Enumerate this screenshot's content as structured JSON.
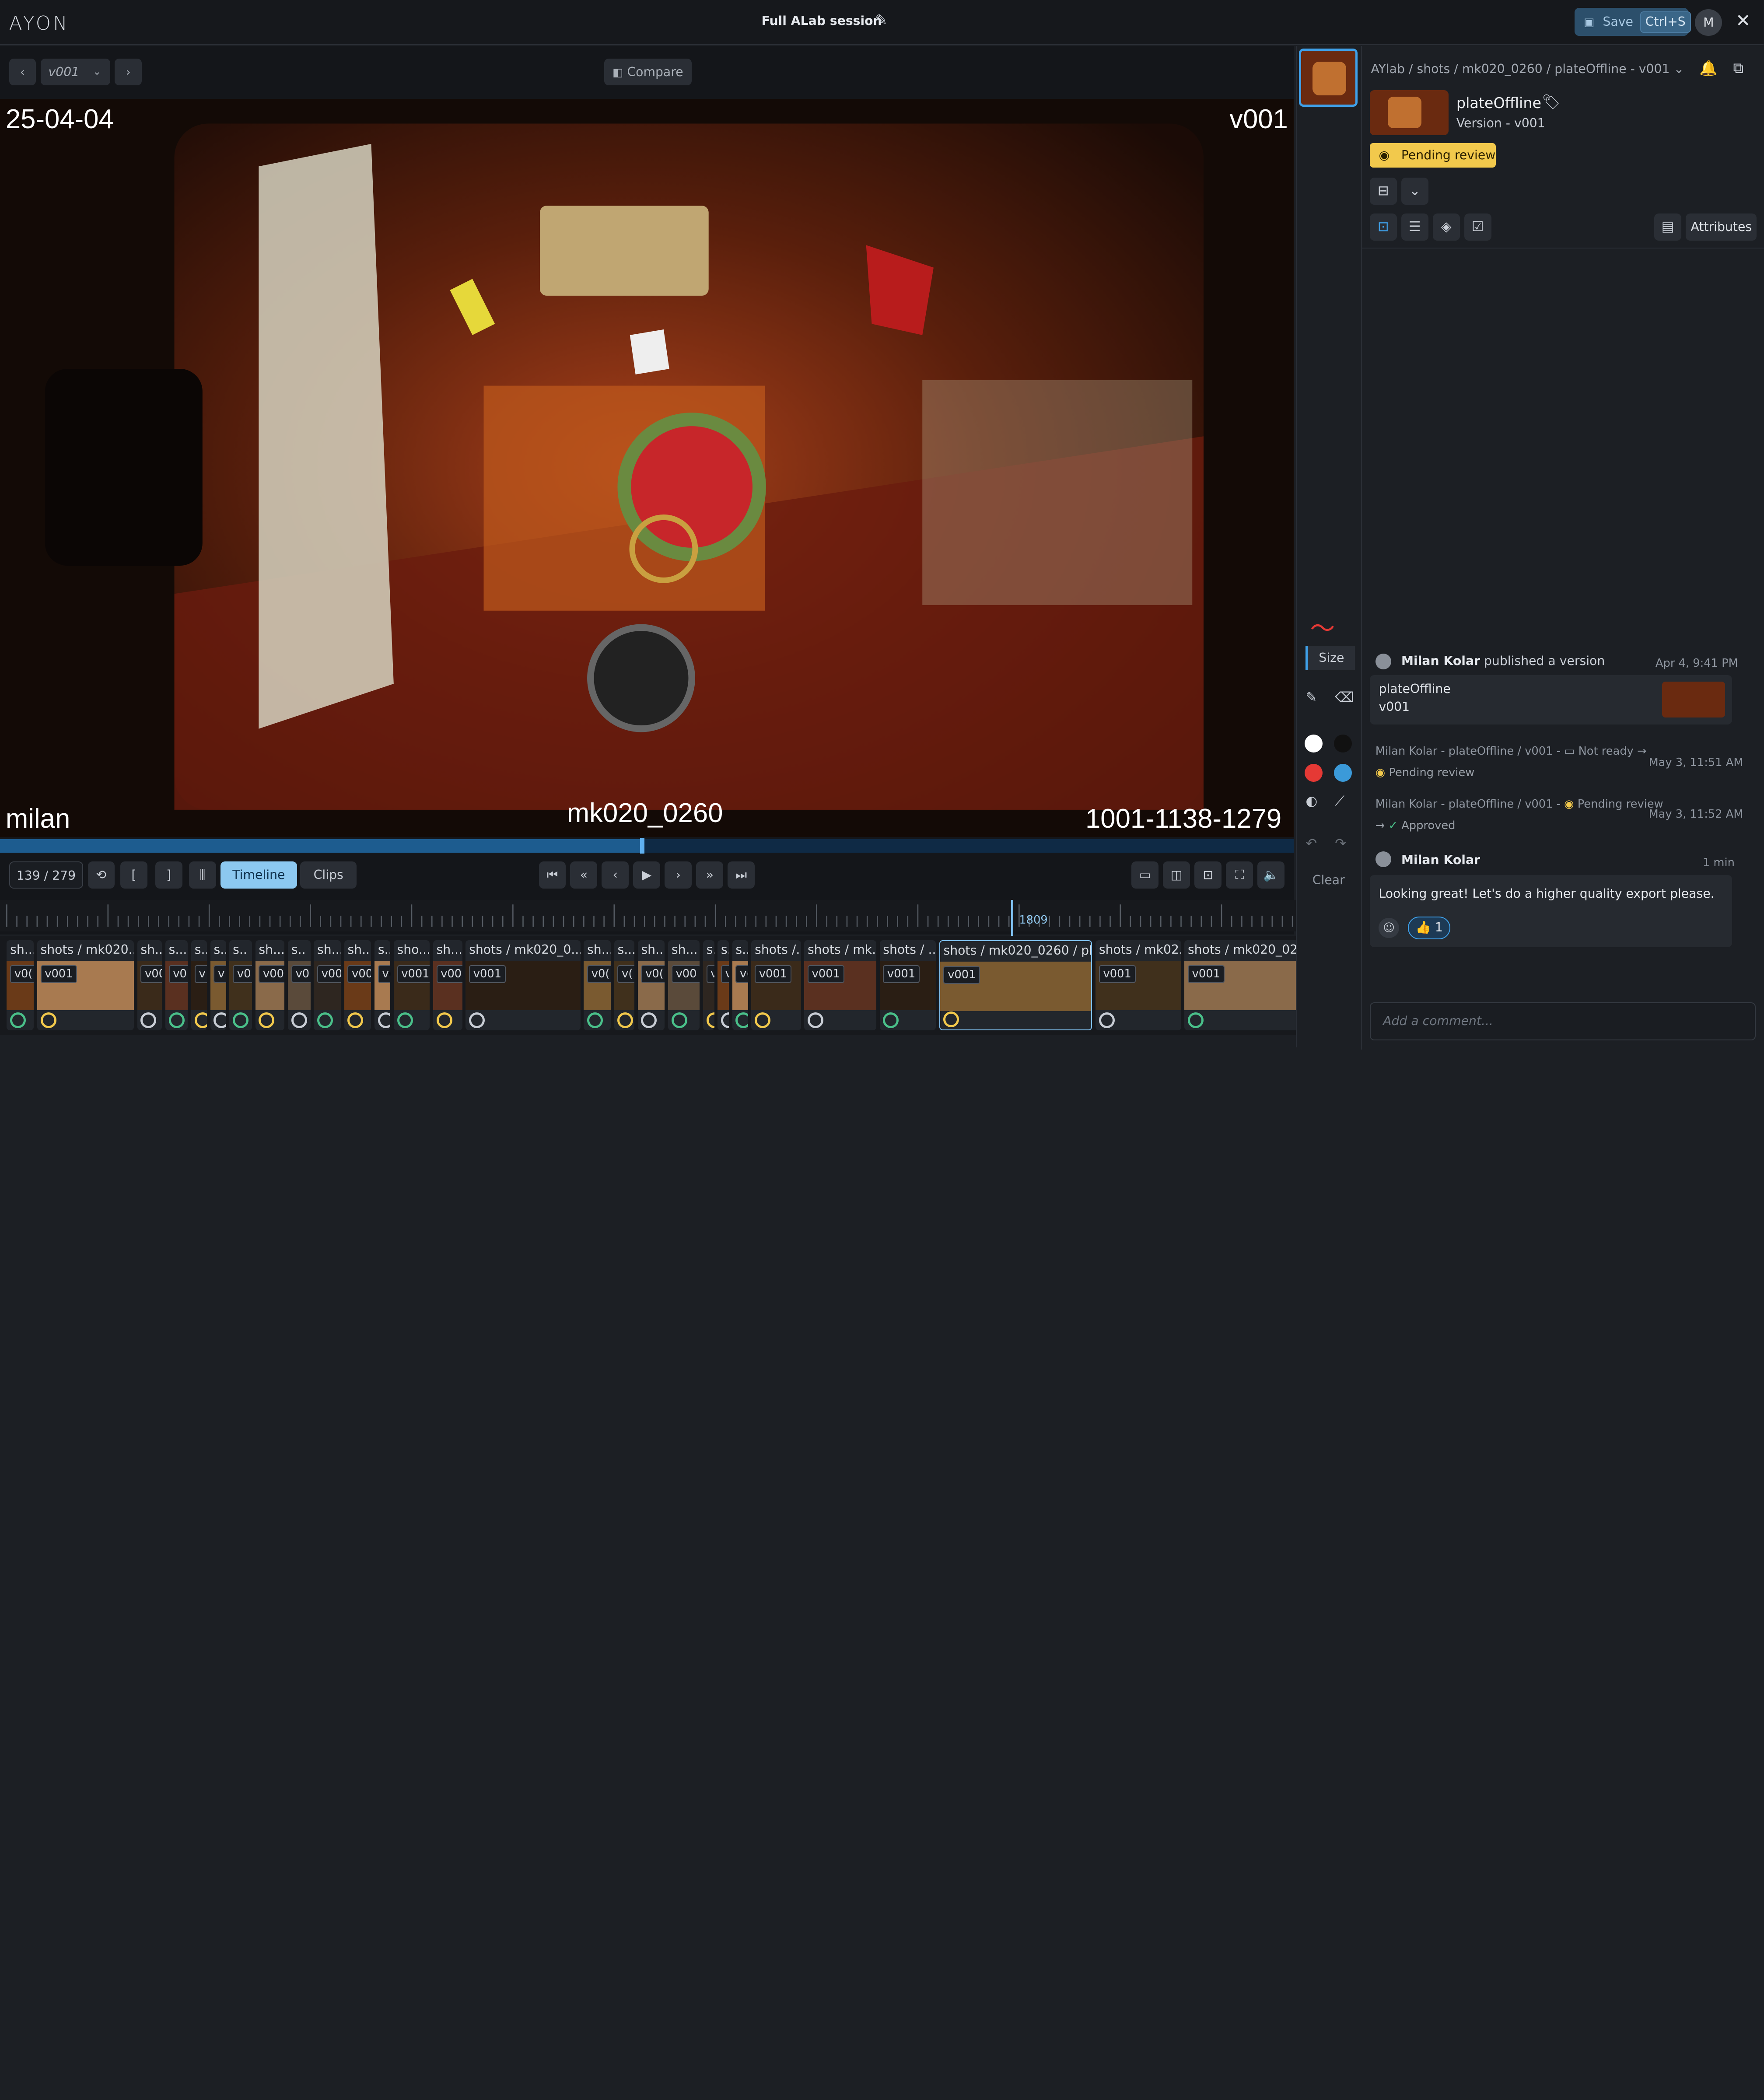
{
  "app": {
    "logo": "AYON",
    "session_title": "Full ALab session",
    "save_label": "Save",
    "save_shortcut": "Ctrl+S",
    "avatar_initial": "M"
  },
  "viewer": {
    "version_select": "v001",
    "compare_label": "Compare",
    "burnin": {
      "date": "25-04-04",
      "version": "v001",
      "user": "milan",
      "shot": "mk020_0260",
      "frames": "1001-1138-1279"
    },
    "frame_counter": "139 / 279",
    "progress": 0.497,
    "tab_timeline": "Timeline",
    "tab_clips": "Clips",
    "ruler_marker": "1809"
  },
  "timeline_clips": [
    {
      "label": "sh...",
      "ver": "v0("
    },
    {
      "label": "shots / mk020...",
      "ver": "v001"
    },
    {
      "label": "sh...",
      "ver": "v00"
    },
    {
      "label": "s...",
      "ver": "v0("
    },
    {
      "label": "s..",
      "ver": "v"
    },
    {
      "label": "s..",
      "ver": "v"
    },
    {
      "label": "s..",
      "ver": "v0"
    },
    {
      "label": "sh...",
      "ver": "v00"
    },
    {
      "label": "s..",
      "ver": "v0"
    },
    {
      "label": "sh...",
      "ver": "v00"
    },
    {
      "label": "sh...",
      "ver": "v00"
    },
    {
      "label": "s..",
      "ver": "v("
    },
    {
      "label": "sho...",
      "ver": "v001"
    },
    {
      "label": "sh...",
      "ver": "v00"
    },
    {
      "label": "shots / mk020_0...",
      "ver": "v001"
    },
    {
      "label": "sh...",
      "ver": "v0("
    },
    {
      "label": "s...",
      "ver": "v("
    },
    {
      "label": "sh...",
      "ver": "v0("
    },
    {
      "label": "sh...",
      "ver": "v00"
    },
    {
      "label": "s..",
      "ver": "v"
    },
    {
      "label": "s..",
      "ver": "v"
    },
    {
      "label": "s..",
      "ver": "v("
    },
    {
      "label": "shots /...",
      "ver": "v001"
    },
    {
      "label": "shots / mk...",
      "ver": "v001"
    },
    {
      "label": "shots / ...",
      "ver": "v001"
    },
    {
      "label": "shots / mk020_0260 / pl...",
      "ver": "v001"
    },
    {
      "label": "shots / mk02...",
      "ver": "v001"
    },
    {
      "label": "shots / mk020_0280 / ...",
      "ver": "v001"
    },
    {
      "label": "s...",
      "ver": "v0"
    }
  ],
  "tools": {
    "size_label": "Size",
    "clear_label": "Clear",
    "colors": [
      "#ffffff",
      "#111111",
      "#e53935",
      "#3b9ad9"
    ]
  },
  "panel": {
    "breadcrumb": {
      "project": "AYlab",
      "sep": "/",
      "folder": "shots",
      "shot": "mk020_0260",
      "version": "plateOffline - v001"
    },
    "product_name": "plateOffline",
    "version_line": "Version -  v001",
    "status": "Pending review",
    "attributes_label": "Attributes",
    "feed": [
      {
        "user": "Milan Kolar",
        "action": "published a version",
        "time": "Apr 4, 9:41 PM",
        "card_title": "plateOffline",
        "card_version": "v001"
      },
      {
        "text": "Milan Kolar - plateOffline / v001 -",
        "from": "Not ready",
        "to": "Pending review",
        "time": "May 3, 11:51 AM"
      },
      {
        "text": "Milan Kolar - plateOffline / v001 -",
        "from": "Pending review",
        "to": "Approved",
        "time": "May 3, 11:52 AM"
      },
      {
        "user": "Milan Kolar",
        "time": "1 min",
        "comment": "Looking great! Let's do a higher quality export please.",
        "reaction": "1"
      }
    ],
    "comment_placeholder": "Add a comment..."
  },
  "colors": {
    "accent": "#3fa0e8",
    "status_pending": "#f2c94c",
    "status_approved": "#4ac08a",
    "bg": "#1c1f24"
  }
}
